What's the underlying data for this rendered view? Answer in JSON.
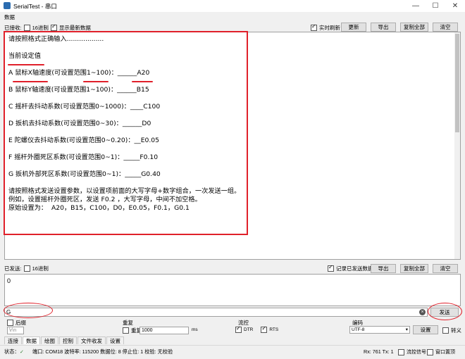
{
  "window": {
    "title": "SerialTest - 串口",
    "minimize": "—",
    "maximize": "☐",
    "close": "✕"
  },
  "rx_section": {
    "label": "数据",
    "received_label": "已接收:",
    "hex_label": "16进制",
    "show_latest_label": "显示最新数据",
    "realtime_label": "实时刷新",
    "update_button": "更新",
    "export_button": "导出",
    "copy_all_button": "复制全部",
    "clear_button": "清空",
    "lines": [
      "请按照格式正确输入..................",
      "",
      "当前设定值",
      "",
      "A 鼠标X轴速度(可设置范围1~100)：______A20",
      "",
      "B 鼠标Y轴速度(可设置范围1~100)：______B15",
      "",
      "C 摇杆去抖动系数(可设置范围0~1000)：____C100",
      "",
      "D 扳机去抖动系数(可设置范围0~30)：______D0",
      "",
      "E 陀螺仪去抖动系数(可设置范围0~0.20)：__E0.05",
      "",
      "F 摇杆外圈死区系数(可设置范围0~1)：_____F0.10",
      "",
      "G 扳机外部死区系数(可设置范围0~1)：_____G0.40",
      "",
      "请按照格式发送设置参数，以设置项前面的大写字母+数字组合，一次发送一组。",
      "例如，设置摇杆外圈死区，发送 F0.2 ，大写字母，中间不加空格。",
      "原始设置为：  A20，B15，C100，D0，E0.05，F0.1，G0.1"
    ]
  },
  "tx_section": {
    "sent_label": "已发送:",
    "hex_label": "16进制",
    "record_label": "记录已发送数据",
    "export_button": "导出",
    "copy_all_button": "复制全部",
    "clear_button": "清空",
    "history_value": "0",
    "input_value": "G",
    "clear_input_icon": "×",
    "send_button": "发送"
  },
  "options": {
    "suffix_label": "后缀",
    "suffix_value": "\\r\\n",
    "repeat_group_label": "重复",
    "repeat_label": "重复",
    "repeat_value": "1000",
    "repeat_unit": "ms",
    "flow_label": "流控",
    "dtr_label": "DTR",
    "rts_label": "RTS",
    "encoding_label": "编码",
    "encoding_value": "UTF-8",
    "settings_button": "设置",
    "escape_label": "转义"
  },
  "tabs": [
    "连接",
    "数据",
    "绘图",
    "控制",
    "文件收发",
    "设置"
  ],
  "status": {
    "state_label": "状态：",
    "port_info": "端口: COM18 波特率: 115200 数据位: 8 停止位: 1 校验: 无校验",
    "rx_tx": "Rx: 761  Tx: 1",
    "flow_signal_label": "流控信号",
    "window_top_label": "窗口置顶"
  },
  "accent_colors": {
    "annotation_red": "#e0202a"
  }
}
